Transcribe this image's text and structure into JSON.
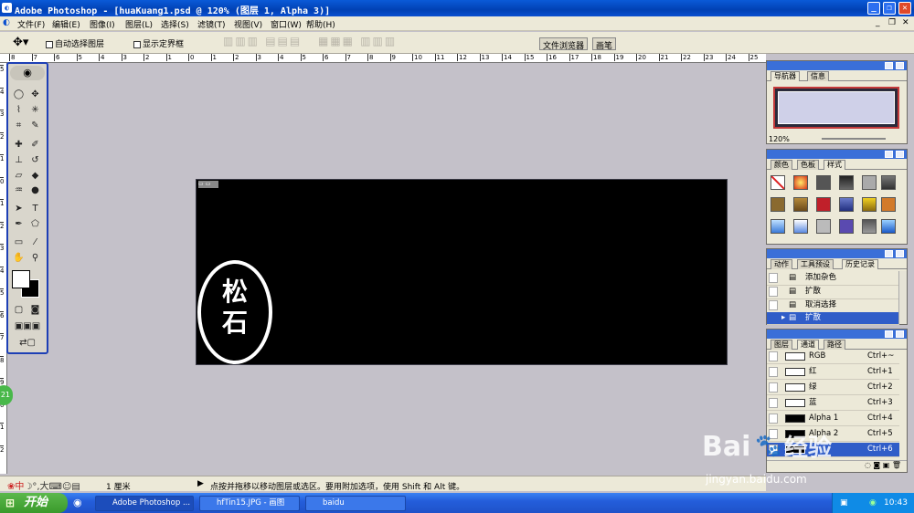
{
  "app": {
    "title": "Adobe Photoshop - [huaKuang1.psd @ 120% (图层 1, Alpha 3)]"
  },
  "menu": [
    "文件(F)",
    "编辑(E)",
    "图像(I)",
    "图层(L)",
    "选择(S)",
    "滤镜(T)",
    "视图(V)",
    "窗口(W)",
    "帮助(H)"
  ],
  "options": {
    "auto_select": "自动选择图层",
    "show_bounds": "显示定界框",
    "tab_file_browser": "文件浏览器",
    "tab_brushes": "画笔"
  },
  "ruler_h": [
    "8",
    "7",
    "6",
    "5",
    "4",
    "3",
    "2",
    "1",
    "0",
    "1",
    "2",
    "3",
    "4",
    "5",
    "6",
    "7",
    "8",
    "9",
    "10",
    "11",
    "12",
    "13",
    "14",
    "15",
    "16",
    "17",
    "18",
    "19",
    "20",
    "21",
    "22",
    "23",
    "24",
    "25"
  ],
  "ruler_v": [
    "5",
    "4",
    "3",
    "2",
    "1",
    "0",
    "1",
    "2",
    "3",
    "4",
    "5",
    "6",
    "7",
    "8",
    "9",
    "0",
    "1",
    "2"
  ],
  "document": {
    "seal_line1": "松",
    "seal_line2": "石"
  },
  "navigator": {
    "tabs": [
      "导航器",
      "信息"
    ],
    "zoom": "120%"
  },
  "swatches_panel": {
    "tabs": [
      "颜色",
      "色板",
      "样式"
    ]
  },
  "history_panel": {
    "tabs": [
      "动作",
      "工具预设",
      "历史记录"
    ],
    "items": [
      "添加杂色",
      "扩散",
      "取消选择",
      "扩散"
    ]
  },
  "channels_panel": {
    "tabs": [
      "图层",
      "通道",
      "路径"
    ],
    "rows": [
      {
        "name": "RGB",
        "shortcut": "Ctrl+~"
      },
      {
        "name": "红",
        "shortcut": "Ctrl+1"
      },
      {
        "name": "绿",
        "shortcut": "Ctrl+2"
      },
      {
        "name": "蓝",
        "shortcut": "Ctrl+3"
      },
      {
        "name": "Alpha 1",
        "shortcut": "Ctrl+4"
      },
      {
        "name": "Alpha 2",
        "shortcut": "Ctrl+5"
      },
      {
        "name": "",
        "shortcut": "Ctrl+6"
      }
    ]
  },
  "status": {
    "size": "1 厘米",
    "hint": "点按并拖移以移动图层或选区。要用附加选项，使用 Shift 和 Alt 键。",
    "ime": "中",
    "ime_big": "大",
    "side_badge": "21"
  },
  "taskbar": {
    "start": "开始",
    "tasks": [
      "Adobe Photoshop ...",
      "hfTin15.JPG - 画图",
      "baidu"
    ],
    "clock": "10:43"
  },
  "watermark": {
    "brand": "Bai",
    "brand_cn": "经验",
    "url": "jingyan.baidu.com"
  },
  "colors": {
    "title_blue": "#0a4fd0",
    "panel_header": "#3a6fd8",
    "selection": "#305dc8",
    "taskbar": "#245edb",
    "start_green": "#3a9a2b"
  }
}
